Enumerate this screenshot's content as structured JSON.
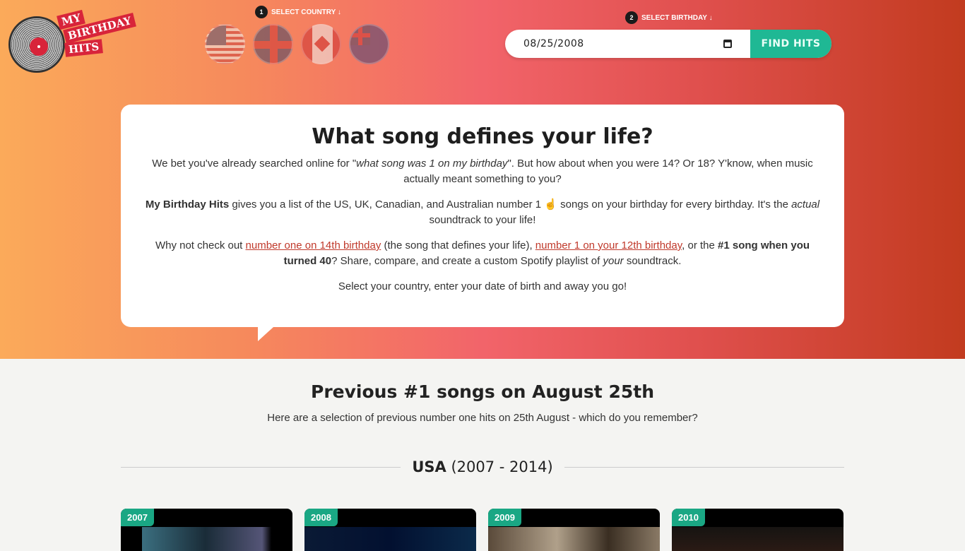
{
  "logo": {
    "line1": "MY",
    "line2": "BIRTHDAY",
    "line3": "HITS"
  },
  "step1": {
    "num": "1",
    "label": "SELECT COUNTRY ↓"
  },
  "step2": {
    "num": "2",
    "label": "SELECT BIRTHDAY ↓"
  },
  "countries": [
    "USA",
    "UK",
    "Canada",
    "Australia"
  ],
  "date_value": "08/25/2008",
  "find_label": "FIND HITS",
  "intro": {
    "title": "What song defines your life?",
    "p1a": "We bet you've already searched online for \"",
    "p1em": "what song was 1 on my birthday",
    "p1b": "\". But how about when you were 14? Or 18? Y'know, when music actually meant something to you?",
    "p2strong": "My Birthday Hits",
    "p2a": " gives you a list of the US, UK, Canadian, and Australian number 1 ☝ songs on your birthday for every birthday. It's the ",
    "p2em": "actual",
    "p2b": " soundtrack to your life!",
    "p3a": "Why not check out ",
    "link1": "number one on 14th birthday",
    "p3b": " (the song that defines your life), ",
    "link2": "number 1 on your 12th birthday",
    "p3c": ", or the ",
    "p3strong": "#1 song when you turned 40",
    "p3d": "? Share, compare, and create a custom Spotify playlist of ",
    "p3em": "your",
    "p3e": " soundtrack.",
    "p4": "Select your country, enter your date of birth and away you go!"
  },
  "previous": {
    "title": "Previous #1 songs on August 25th",
    "subtitle": "Here are a selection of previous number one hits on 25th August - which do you remember?"
  },
  "usa_section": {
    "country": "USA",
    "range": "(2007 - 2014)"
  },
  "cards": [
    {
      "year": "2007"
    },
    {
      "year": "2008"
    },
    {
      "year": "2009"
    },
    {
      "year": "2010"
    }
  ],
  "colors": {
    "accent": "#1fb894",
    "brand": "#d8243a",
    "link": "#c0392b"
  }
}
